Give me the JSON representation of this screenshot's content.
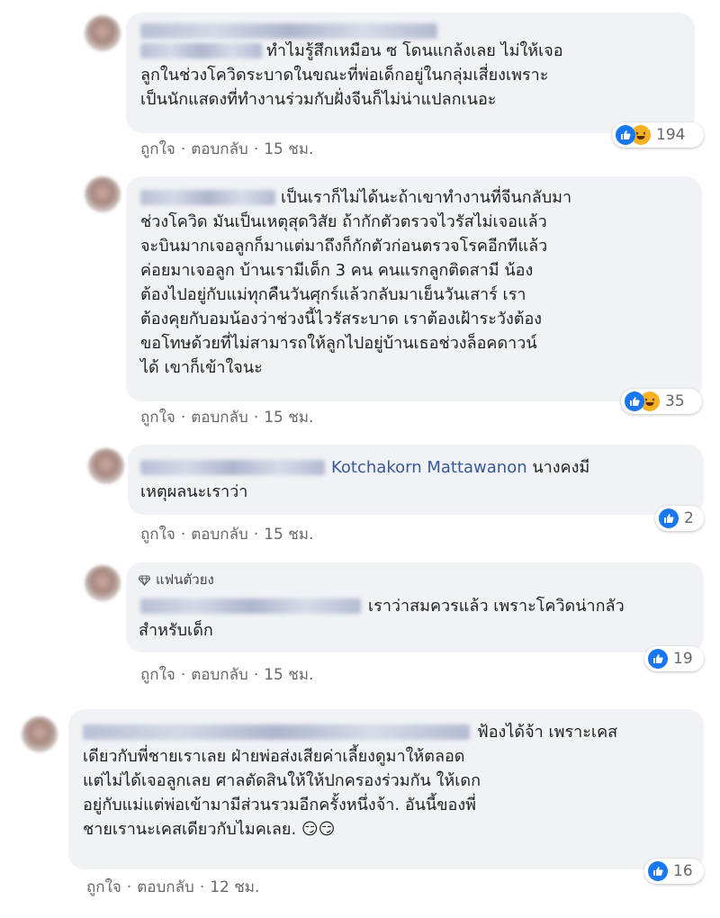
{
  "comments": [
    {
      "text_after_name": "ทำไมรู้สึกเหมือน ซ โดนแกล้งเลย ไม่ให้เจอ\nลูกในช่วงโควิดระบาดในขณะที่พ่อเด็กอยู่ในกลุ่มเสี่ยงเพราะ\nเป็นนักแสดงที่ทำงานร่วมกับฝั่งจีนก็ไม่น่าแปลกเนอะ",
      "like_label": "ถูกใจ",
      "reply_label": "ตอบกลับ",
      "time": "15 ชม.",
      "reactions": [
        "like",
        "haha"
      ],
      "reaction_count": "194"
    },
    {
      "text_after_name": "เป็นเราก็ไม่ได้นะถ้าเขาทำงานที่จีนกลับมา\nช่วงโควิด มันเป็นเหตุสุดวิสัย ถ้ากักตัวตรวจไวรัสไม่เจอแล้ว\nจะบินมากเจอลูกก็มาแต่มาถึงก็กักตัวก่อนตรวจโรคอีกทีแล้ว\nค่อยมาเจอลูก บ้านเรามีเด็ก 3 คน คนแรกลูกติดสามี น้อง\nต้องไปอยู่กับแม่ทุกคืนวันศุกร์แล้วกลับมาเย็นวันเสาร์ เรา\nต้องคุยกับอมน้องว่าช่วงนี้ไวรัสระบาด เราต้องเฝ้าระวังต้อง\nขอโทษด้วยที่ไม่สามารถให้ลูกไปอยู่บ้านเธอช่วงล็อคดาวน์\nได้ เขาก็เข้าใจนะ",
      "like_label": "ถูกใจ",
      "reply_label": "ตอบกลับ",
      "time": "15 ชม.",
      "reactions": [
        "like",
        "haha"
      ],
      "reaction_count": "35"
    },
    {
      "mention": "Kotchakorn Mattawanon",
      "text_after_name": "นางคงมี\nเหตุผลนะเราว่า",
      "like_label": "ถูกใจ",
      "reply_label": "ตอบกลับ",
      "time": "15 ชม.",
      "reactions": [
        "like"
      ],
      "reaction_count": "2"
    },
    {
      "badge": "แฟนตัวยง",
      "text_after_name": "เราว่าสมควรแล้ว เพราะโควิดน่ากลัว\nสำหรับเด็ก",
      "like_label": "ถูกใจ",
      "reply_label": "ตอบกลับ",
      "time": "15 ชม.",
      "reactions": [
        "like"
      ],
      "reaction_count": "19"
    },
    {
      "text_after_name": "ฟ้องได้จ้า เพราะเคส\nเดียวกับพี่ชายเราเลย ฝ่ายพ่อส่งเสียค่าเลี้ยงดูมาให้ตลอด\nแต่ไม่ได้เจอลูกเลย ศาลตัดสินให้ให้ปกครองร่วมกัน ให้เดก\nอยู่กับแม่แต่พ่อเข้ามามีส่วนรวมอีกครั้งหนึ่งจ้า. อันนี้ของพี่\nชายเรานะเคสเดียวกับไมคเลย. 😏😏",
      "like_label": "ถูกใจ",
      "reply_label": "ตอบกลับ",
      "time": "12 ชม.",
      "reactions": [
        "like"
      ],
      "reaction_count": "16"
    }
  ],
  "colors": {
    "bubble": "#f0f2f5",
    "name_link": "#385898",
    "meta_text": "#65676b",
    "like_blue": "#1877f2",
    "haha_yellow": "#f7b125"
  }
}
